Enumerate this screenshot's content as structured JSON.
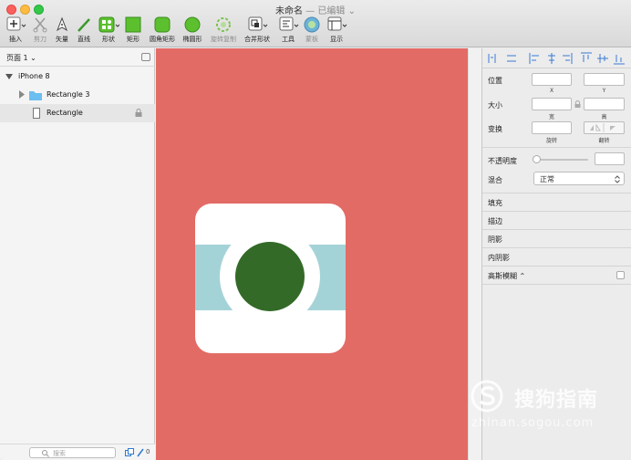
{
  "window": {
    "title": "未命名",
    "subtitle": "— 已编辑 ⌄"
  },
  "toolbar": {
    "insert": "插入",
    "scissors": "剪刀",
    "vector": "矢量",
    "line": "直线",
    "shape": "形状",
    "rect": "矩形",
    "rounded_rect": "圆角矩形",
    "oval": "椭圆形",
    "rotate_copy": "旋转复制",
    "combine": "合并形状",
    "tools": "工具",
    "mask": "蒙板",
    "view": "显示"
  },
  "sidebar": {
    "page": "页面 1 ⌄",
    "artboard": "iPhone 8",
    "layers": [
      {
        "label": "Rectangle 3"
      },
      {
        "label": "Rectangle"
      }
    ],
    "search_placeholder": "搜索",
    "count": "0"
  },
  "inspector": {
    "position": "位置",
    "x": "X",
    "y": "Y",
    "size": "大小",
    "width": "宽",
    "height": "高",
    "transform": "变换",
    "rotate": "旋转",
    "flip": "翻转",
    "opacity": "不透明度",
    "blend": "混合",
    "blend_value": "正常",
    "sections": [
      "填充",
      "描边",
      "阴影",
      "内阴影"
    ],
    "blur": "高斯模糊 ⌃"
  },
  "watermark": {
    "brand": "搜狗指南",
    "url": "zhinan.sogou.com"
  },
  "colors": {
    "canvas": "#e36b65",
    "card": "#ffffff",
    "band": "#a4d3d7",
    "lens": "#336a27",
    "folder": "#6bbef0"
  }
}
